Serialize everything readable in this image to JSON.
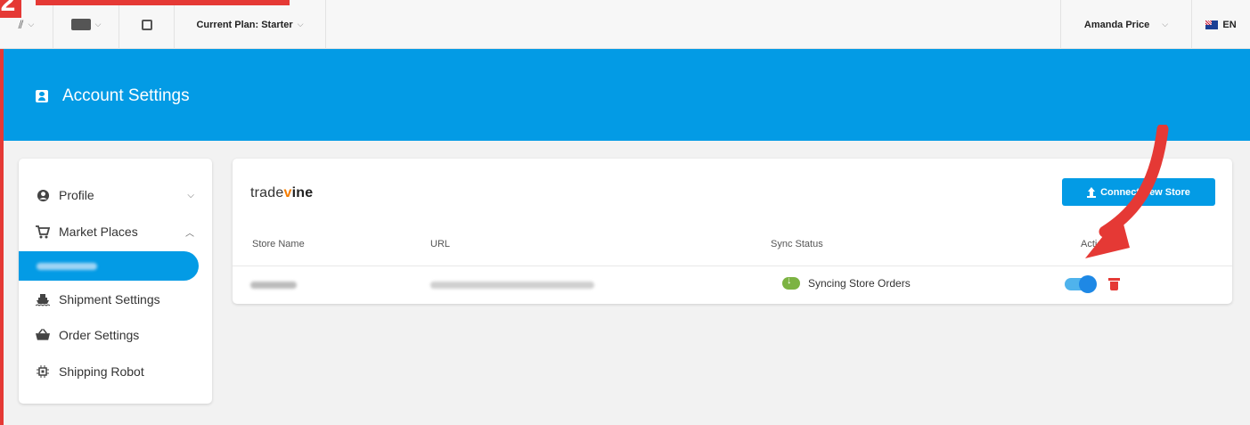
{
  "topbar": {
    "plan_label": "Current Plan: Starter",
    "user_name": "Amanda Price",
    "language": "EN",
    "step_badge": "2"
  },
  "banner": {
    "title": "Account Settings"
  },
  "sidebar": {
    "items": [
      {
        "label": "Profile",
        "icon": "user-circle-icon",
        "expanded": false
      },
      {
        "label": "Market Places",
        "icon": "cart-icon",
        "expanded": true
      },
      {
        "label": "Shipment Settings",
        "icon": "ship-icon"
      },
      {
        "label": "Order Settings",
        "icon": "basket-icon"
      },
      {
        "label": "Shipping Robot",
        "icon": "robot-chip-icon"
      }
    ],
    "active_subitem": "redacted"
  },
  "main": {
    "logo_text_regular": "trade",
    "logo_text_accent": "v",
    "logo_text_bold": "ine",
    "connect_button": "Connect New Store",
    "columns": [
      "Store Name",
      "URL",
      "Sync Status",
      "Actions"
    ],
    "rows": [
      {
        "store_name": "redacted",
        "url": "redacted",
        "sync_status": "Syncing Store Orders",
        "active": true
      }
    ]
  },
  "colors": {
    "accent": "#039be5",
    "danger": "#e53935",
    "sync_ok": "#7cb342"
  }
}
